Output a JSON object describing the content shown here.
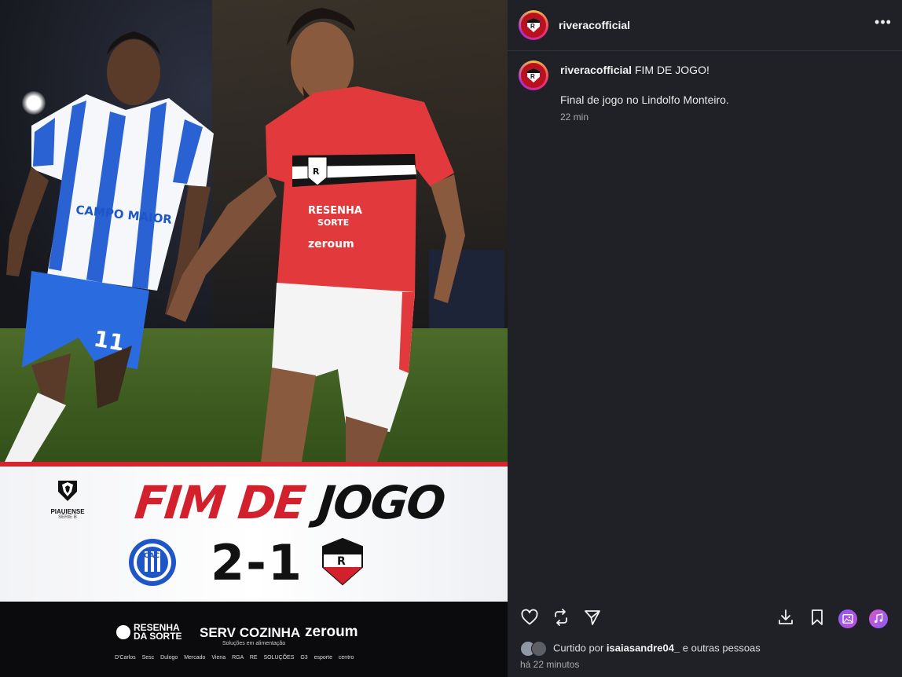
{
  "post": {
    "username": "riveracofficial",
    "caption_title": "FIM DE JOGO!",
    "caption_body": "Final de jogo no Lindolfo Monteiro.",
    "caption_time": "22 min",
    "liked_by_prefix": "Curtido por ",
    "liked_by_user": "isaiasandre04_",
    "liked_by_suffix": " e outras pessoas",
    "age": "há 22 minutos",
    "more_label": "•••"
  },
  "media": {
    "headline_red": "FIM DE",
    "headline_black": "JOGO",
    "league_name": "PIAUIENSE",
    "league_sub": "SÉRIE B",
    "score": "2-1",
    "home_badge_letters": "CAC",
    "away_badge_letter": "R",
    "jersey_number": "11",
    "home_shirt_text": "CAMPO MAIOR",
    "away_shirt_text_1": "RESENHA",
    "away_shirt_text_2": "SORTE",
    "away_shirt_text_3": "zeroum",
    "sponsor_1_line1": "RESENHA",
    "sponsor_1_line2": "DA SORTE",
    "sponsor_2": "SERV COZINHA",
    "sponsor_2_sub": "Soluções em alimentação",
    "sponsor_3": "zeroum",
    "small_sponsors": "D'Carlos  Sesc  Dulogo  Mercado  Viena  RGA  RE SOLUÇÕES  G3  esporte  centro"
  },
  "colors": {
    "panel_bg": "#1f2126",
    "accent_red": "#d2202c",
    "home_blue": "#1e56c8",
    "away_red": "#e23a3c"
  },
  "icons": [
    "more-icon",
    "heart-icon",
    "repost-icon",
    "share-icon",
    "download-icon",
    "bookmark-icon",
    "image-icon",
    "music-icon"
  ]
}
